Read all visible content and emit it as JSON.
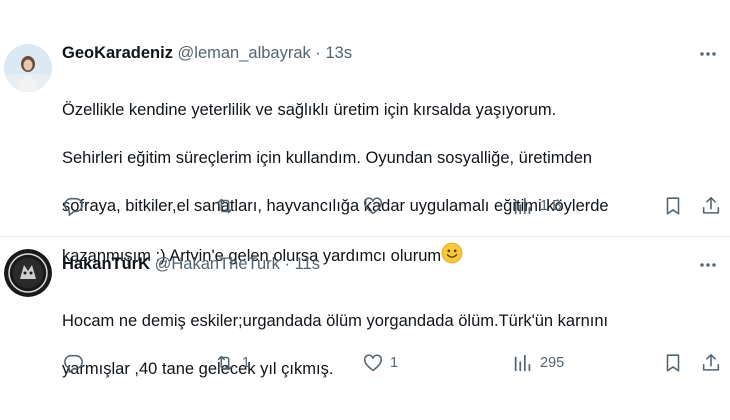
{
  "tweets": [
    {
      "display_name": "GeoKaradeniz",
      "handle": "@leman_albayrak",
      "separator": "·",
      "time": "13s",
      "text_lines": [
        "Özellikle kendine yeterlilik ve sağlıklı üretim için kırsalda  yaşıyorum.",
        "Sehirleri eğitim süreçlerim için kullandım. Oyundan sosyalliğe, üretimden",
        "sofraya, bitkiler,el sanatları, hayvancılığa kadar uygulamalı eğitimi köylerde",
        "kazanmışım :) Artvin'e gelen olursa yardımcı olurum"
      ],
      "emoji": "smiling-face-emoji",
      "reply_count": "",
      "retweet_count": "",
      "like_count": "",
      "view_count": "1 B"
    },
    {
      "display_name": "HakanTürK",
      "handle": "@HakanTheTurk",
      "separator": "·",
      "time": "11s",
      "text_lines": [
        "Hocam ne demiş eskiler;urgandada ölüm yorgandada ölüm.Türk'ün karnını",
        "yarmışlar ,40 tane gelecek yıl çıkmış."
      ],
      "reply_count": "",
      "retweet_count": "1",
      "like_count": "1",
      "view_count": "295"
    }
  ],
  "colors": {
    "text": "#0f1419",
    "secondary": "#536471",
    "divider": "#e7e9ea",
    "emoji_fill": "#f7c83b"
  }
}
